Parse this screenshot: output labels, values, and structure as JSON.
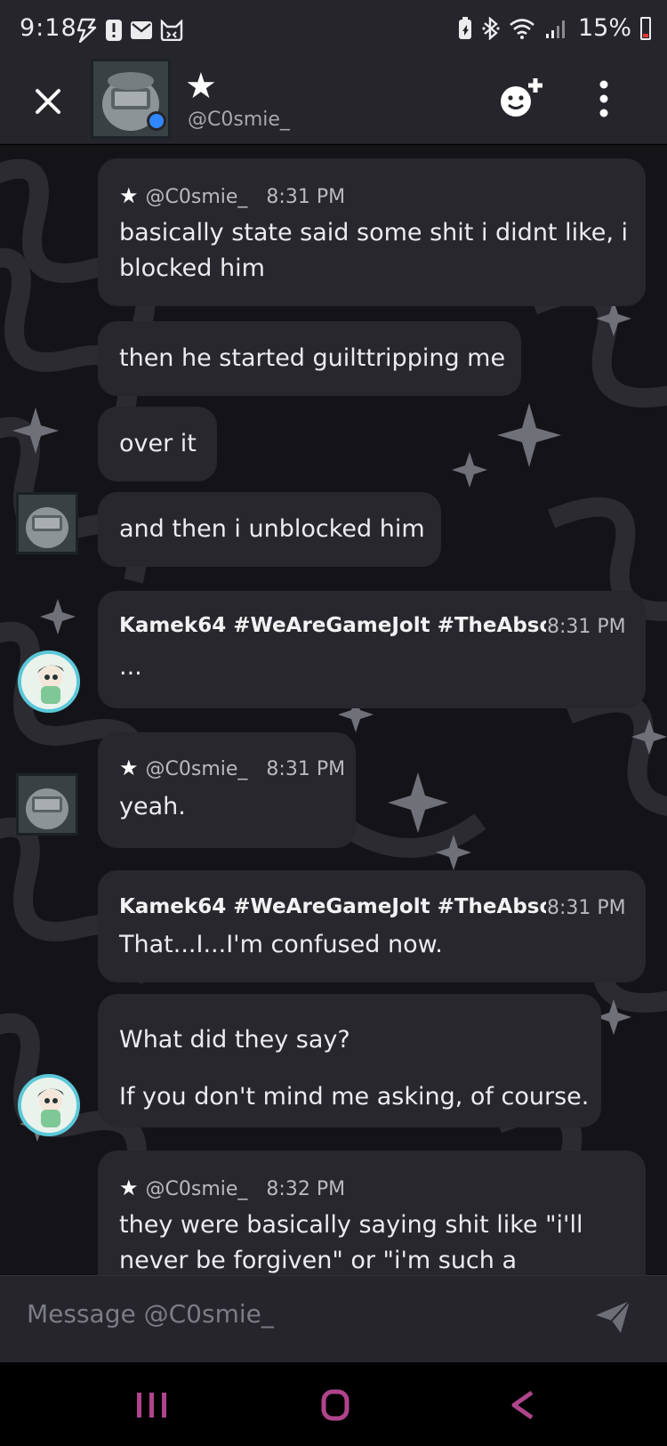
{
  "status": {
    "time": "9:18",
    "battery_percent": "15%",
    "left_icons": [
      "bolt-icon",
      "alert-icon",
      "mail-icon",
      "cat-icon"
    ],
    "right_icons": [
      "battery-saver-icon",
      "bluetooth-icon",
      "wifi-icon",
      "signal-icon"
    ]
  },
  "header": {
    "name": "★",
    "handle": "@C0smie_",
    "online": true
  },
  "messages": [
    {
      "meta_prefix": "★",
      "author": "@C0smie_",
      "time": "8:31 PM",
      "lines": [
        "basically state said some shit i didnt like, i",
        "blocked him"
      ]
    },
    {
      "lines": [
        "then he started guilttripping me"
      ]
    },
    {
      "lines": [
        "over it"
      ]
    },
    {
      "lines": [
        "and then i unblocked him"
      ]
    },
    {
      "author": "Kamek64 #WeAreGameJolt #TheAbso",
      "time": "8:31 PM",
      "lines": [
        "..."
      ]
    },
    {
      "meta_prefix": "★",
      "author": "@C0smie_",
      "time": "8:31 PM",
      "lines": [
        "yeah."
      ]
    },
    {
      "author": "Kamek64 #WeAreGameJolt #TheAbso",
      "time": "8:31 PM",
      "lines": [
        "That...I...I'm confused now."
      ]
    },
    {
      "lines": [
        "What did they say?",
        "If you don't mind me asking, of course."
      ]
    },
    {
      "meta_prefix": "★",
      "author": "@C0smie_",
      "time": "8:32 PM",
      "lines": [
        "they were basically saying shit like \"i'll",
        "never be forgiven\" or \"i'm such a"
      ]
    }
  ],
  "composer": {
    "placeholder": "Message @C0smie_"
  },
  "colors": {
    "bar": "#25252b",
    "bubble": "#27272d",
    "accent_blue": "#2f88ff",
    "nav_purple": "#b0448c"
  }
}
